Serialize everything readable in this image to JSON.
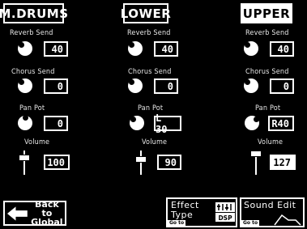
{
  "tabs": [
    {
      "label": "M.DRUMS",
      "selected": false
    },
    {
      "label": "LOWER",
      "selected": false
    },
    {
      "label": "UPPER",
      "selected": true
    }
  ],
  "columns": [
    {
      "reverb": {
        "label": "Reverb Send",
        "value": "40"
      },
      "chorus": {
        "label": "Chorus Send",
        "value": "0"
      },
      "pan": {
        "label": "Pan Pot",
        "value": "0"
      },
      "volume": {
        "label": "Volume",
        "value": "100",
        "level": 0.79
      }
    },
    {
      "reverb": {
        "label": "Reverb Send",
        "value": "40"
      },
      "chorus": {
        "label": "Chorus Send",
        "value": "0"
      },
      "pan": {
        "label": "Pan Pot",
        "value": "L 30"
      },
      "volume": {
        "label": "Volume",
        "value": "90",
        "level": 0.71
      }
    },
    {
      "reverb": {
        "label": "Reverb Send",
        "value": "40"
      },
      "chorus": {
        "label": "Chorus Send",
        "value": "0"
      },
      "pan": {
        "label": "Pan Pot",
        "value": "R40"
      },
      "volume": {
        "label": "Volume",
        "value": "127",
        "level": 1.0
      }
    }
  ],
  "buttons": {
    "back": {
      "line1": "Back to",
      "line2": "Global"
    },
    "effect": {
      "line1": "Effect",
      "line2": "Type",
      "goto": "Go to",
      "icon": "dsp-icon"
    },
    "sound": {
      "line1": "Sound Edit",
      "goto": "Go to",
      "icon": "envelope-icon"
    }
  },
  "colors": {
    "background": "#000000",
    "foreground": "#ffffff"
  }
}
